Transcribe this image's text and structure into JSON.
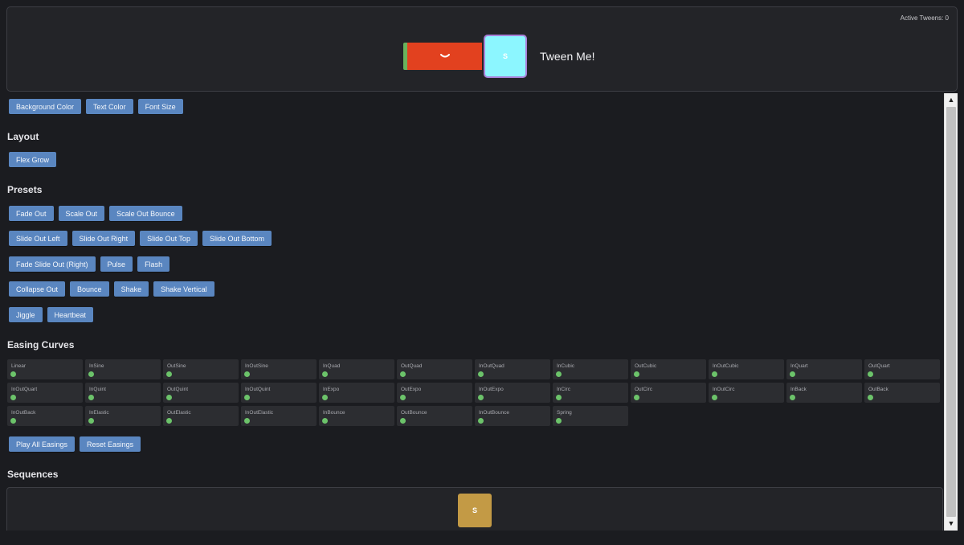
{
  "demo": {
    "active_tweens": "Active Tweens: 0",
    "bar_icon": "chevron-down-icon",
    "box_label": "S",
    "tween_text": "Tween Me!",
    "colors": {
      "bar": "#e2411f",
      "box": "#8cf6ff",
      "box_border": "#a880d8"
    }
  },
  "properties": {
    "buttons": [
      "Background Color",
      "Text Color",
      "Font Size"
    ]
  },
  "layout": {
    "title": "Layout",
    "buttons": [
      "Flex Grow"
    ]
  },
  "presets": {
    "title": "Presets",
    "rows": [
      [
        "Fade Out",
        "Scale Out",
        "Scale Out Bounce"
      ],
      [
        "Slide Out Left",
        "Slide Out Right",
        "Slide Out Top",
        "Slide Out Bottom"
      ],
      [
        "Fade Slide Out (Right)",
        "Pulse",
        "Flash"
      ],
      [
        "Collapse Out",
        "Bounce",
        "Shake",
        "Shake Vertical"
      ],
      [
        "Jiggle",
        "Heartbeat"
      ]
    ]
  },
  "easing": {
    "title": "Easing Curves",
    "curves": [
      "Linear",
      "InSine",
      "OutSine",
      "InOutSine",
      "InQuad",
      "OutQuad",
      "InOutQuad",
      "InCubic",
      "OutCubic",
      "InOutCubic",
      "InQuart",
      "OutQuart",
      "InOutQuart",
      "InQuint",
      "OutQuint",
      "InOutQuint",
      "InExpo",
      "OutExpo",
      "InOutExpo",
      "InCirc",
      "OutCirc",
      "InOutCirc",
      "InBack",
      "OutBack",
      "InOutBack",
      "InElastic",
      "OutElastic",
      "InOutElastic",
      "InBounce",
      "OutBounce",
      "InOutBounce",
      "Spring"
    ],
    "dot_color": "#6cc36a",
    "play_all": "Play All Easings",
    "reset": "Reset Easings"
  },
  "sequences": {
    "title": "Sequences",
    "box_label": "S",
    "box_color": "#c39a45"
  },
  "scrollbar": {
    "up_icon": "▲",
    "down_icon": "▼"
  }
}
